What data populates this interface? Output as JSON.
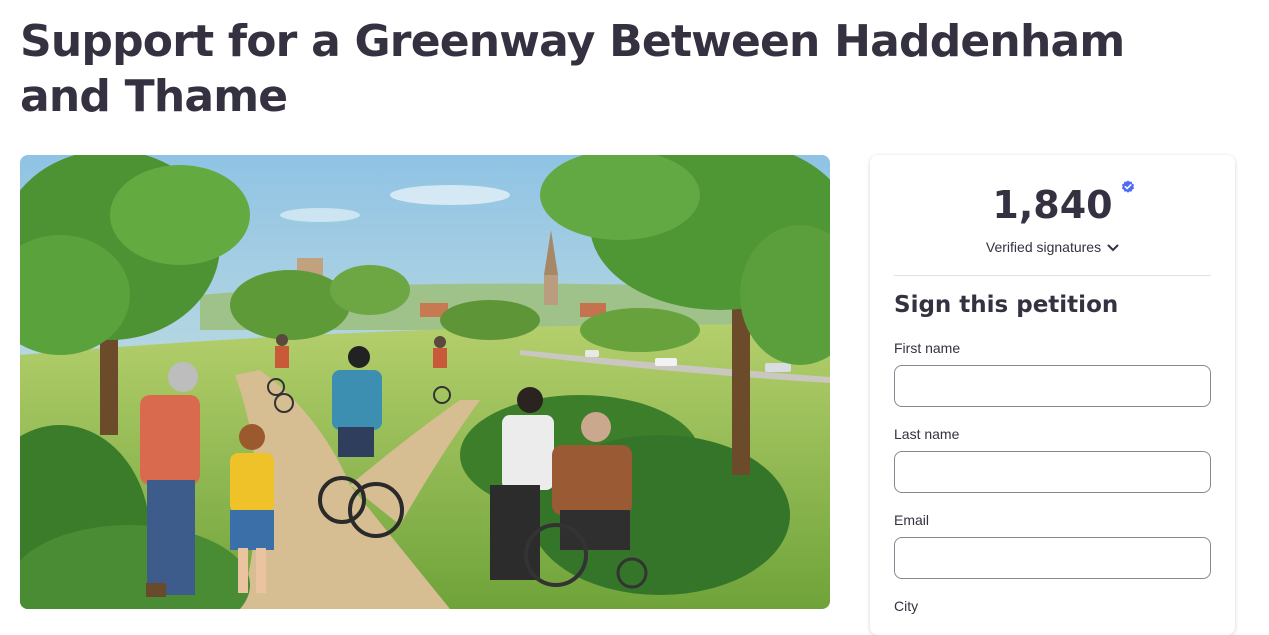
{
  "page": {
    "title": "Support for a Greenway Between Haddenham and Thame"
  },
  "signatures": {
    "count": "1,840",
    "label": "Verified signatures"
  },
  "form": {
    "heading": "Sign this petition",
    "fields": [
      {
        "label": "First name",
        "value": ""
      },
      {
        "label": "Last name",
        "value": ""
      },
      {
        "label": "Email",
        "value": ""
      },
      {
        "label": "City",
        "value": ""
      }
    ]
  },
  "colors": {
    "title": "#363140",
    "verified_badge": "#4a6cf7",
    "border": "#8a8794"
  },
  "icons": {
    "verified": "verified-check-icon",
    "expand": "chevron-down-icon"
  }
}
